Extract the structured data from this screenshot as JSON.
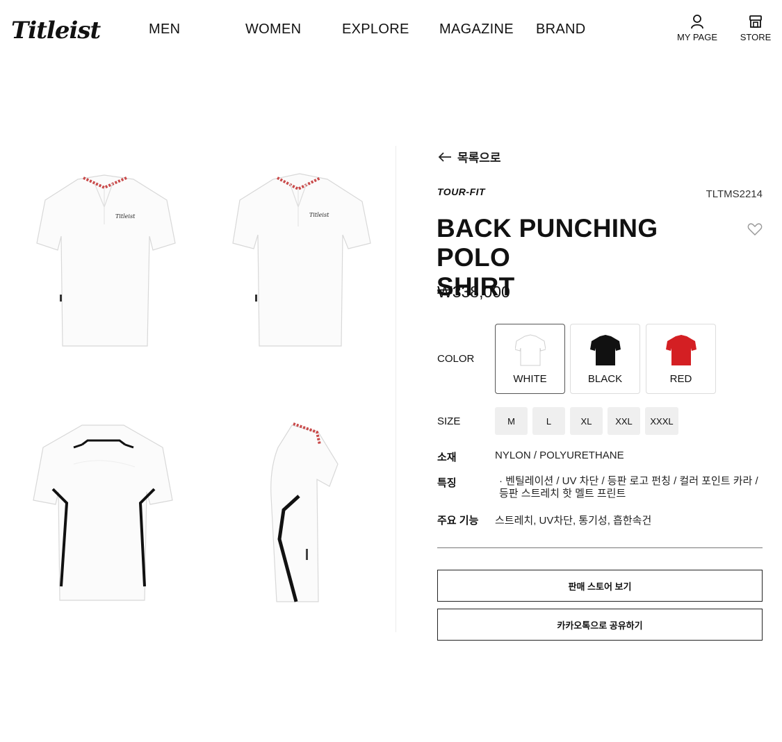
{
  "header": {
    "logo": "Titleist",
    "nav": [
      "MEN",
      "WOMEN",
      "EXPLORE",
      "MAGAZINE",
      "BRAND"
    ],
    "my_page": "MY PAGE",
    "store": "STORE"
  },
  "product": {
    "back_label": "목록으로",
    "line": "TOUR-FIT",
    "sku": "TLTMS2214",
    "title_line1": "BACK PUNCHING POLO",
    "title_line2": "SHIRT",
    "price": "₩338,000",
    "color_label": "COLOR",
    "colors": [
      {
        "name": "WHITE",
        "hex": "#ffffff",
        "selected": true
      },
      {
        "name": "BLACK",
        "hex": "#111111",
        "selected": false
      },
      {
        "name": "RED",
        "hex": "#d41f23",
        "selected": false
      }
    ],
    "size_label": "SIZE",
    "sizes": [
      "M",
      "L",
      "XL",
      "XXL",
      "XXXL"
    ],
    "material_label": "소재",
    "material": "NYLON / POLYURETHANE",
    "feature_label": "특징",
    "features": "· 벤틸레이션 / UV 차단 / 등판 로고 펀칭 / 컬러 포인트 카라 / 등판 스트레치 핫 멜트 프린트",
    "function_label": "주요 기능",
    "functions": "스트레치, UV차단, 통기성, 흡한속건",
    "store_button": "판매 스토어 보기",
    "share_button": "카카오톡으로 공유하기"
  },
  "gallery": {
    "views": [
      "front",
      "front-angle",
      "back",
      "side"
    ],
    "chest_logo": "Titleist"
  }
}
